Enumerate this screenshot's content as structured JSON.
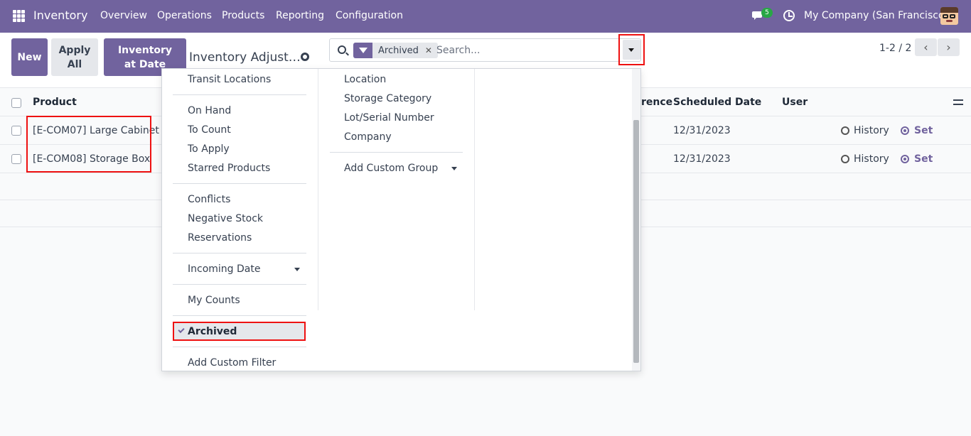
{
  "topbar": {
    "brand": "Inventory",
    "menu": [
      "Overview",
      "Operations",
      "Products",
      "Reporting",
      "Configuration"
    ],
    "chat_count": "5",
    "company": "My Company (San Francisco)"
  },
  "control": {
    "new_label": "New",
    "apply_all_label": "Apply All",
    "inventory_at_date_label": "Inventory at Date",
    "breadcrumb": "Inventory Adjust…",
    "search": {
      "facet_label": "Archived",
      "placeholder": "Search..."
    },
    "pager": "1-2 / 2"
  },
  "table": {
    "headers": {
      "product": "Product",
      "reference": "rence",
      "scheduled_date": "Scheduled Date",
      "user": "User"
    },
    "rows": [
      {
        "product": "[E-COM07] Large Cabinet",
        "scheduled_date": "12/31/2023",
        "history": "History",
        "set": "Set"
      },
      {
        "product": "[E-COM08] Storage Box",
        "scheduled_date": "12/31/2023",
        "history": "History",
        "set": "Set"
      }
    ]
  },
  "filters": {
    "transit": "Transit Locations",
    "on_hand": "On Hand",
    "to_count": "To Count",
    "to_apply": "To Apply",
    "starred": "Starred Products",
    "conflicts": "Conflicts",
    "negative": "Negative Stock",
    "reservations": "Reservations",
    "incoming_date": "Incoming Date",
    "my_counts": "My Counts",
    "archived": "Archived",
    "add_custom": "Add Custom Filter"
  },
  "groupby": {
    "location": "Location",
    "storage_category": "Storage Category",
    "lot_serial": "Lot/Serial Number",
    "company": "Company",
    "add_custom_group": "Add Custom Group"
  },
  "colors": {
    "brand": "#71639e",
    "highlight": "#e11111",
    "badge": "#28a745"
  }
}
